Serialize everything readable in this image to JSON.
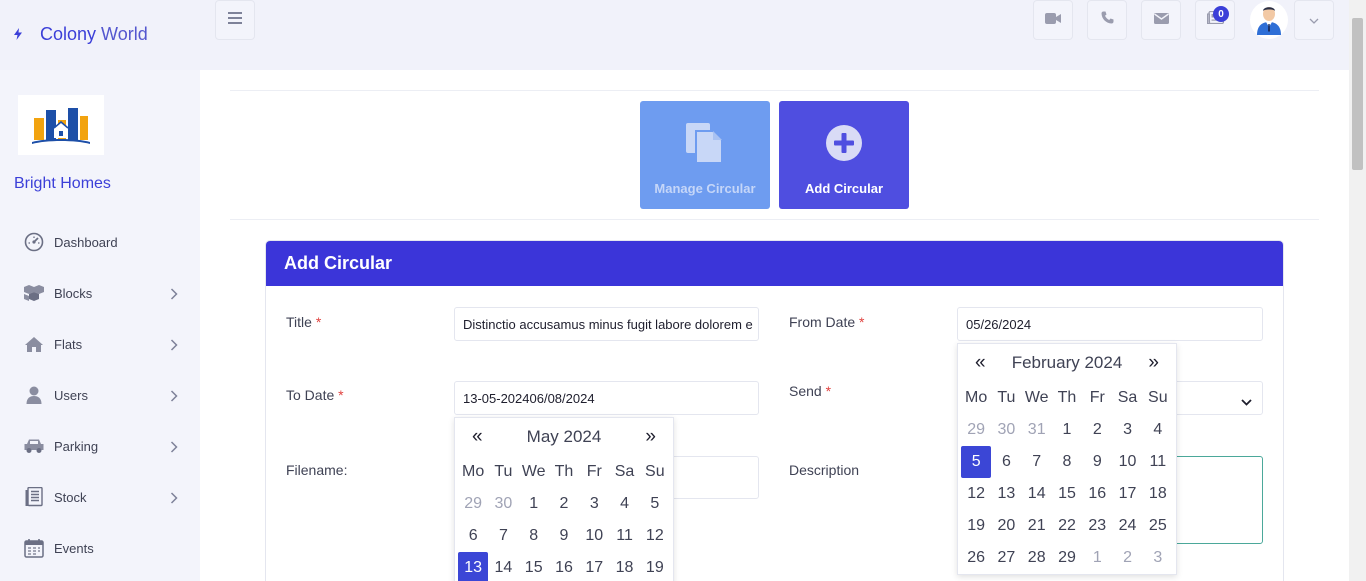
{
  "app": {
    "brand_first": "Colony",
    "brand_second": "World"
  },
  "topbar": {
    "menu_icon": "hamburger-icon",
    "actions": [
      {
        "name": "video-call",
        "icon": "video-icon"
      },
      {
        "name": "phone",
        "icon": "phone-icon"
      },
      {
        "name": "mail",
        "icon": "envelope-icon"
      },
      {
        "name": "notifications",
        "icon": "newspaper-icon",
        "badge": "0"
      }
    ],
    "user_menu_icon": "chevron-down-icon"
  },
  "sidebar": {
    "org_name": "Bright Homes",
    "items": [
      {
        "label": "Dashboard",
        "icon": "speedometer-icon",
        "has_children": false
      },
      {
        "label": "Blocks",
        "icon": "cubes-icon",
        "has_children": true
      },
      {
        "label": "Flats",
        "icon": "home-icon",
        "has_children": true
      },
      {
        "label": "Users",
        "icon": "user-icon",
        "has_children": true
      },
      {
        "label": "Parking",
        "icon": "car-icon",
        "has_children": true
      },
      {
        "label": "Stock",
        "icon": "stock-icon",
        "has_children": true
      },
      {
        "label": "Events",
        "icon": "calendar-icon",
        "has_children": false
      }
    ]
  },
  "tiles": {
    "manage": {
      "label": "Manage Circular",
      "icon": "documents-icon"
    },
    "add": {
      "label": "Add Circular",
      "icon": "plus-circle-icon"
    }
  },
  "form": {
    "heading": "Add Circular",
    "required_mark": "*",
    "title_label": "Title",
    "title_value": "Distinctio accusamus minus fugit labore dolorem e",
    "from_date_label": "From Date",
    "from_date_value": "05/26/2024",
    "to_date_label": "To Date",
    "to_date_value": "13-05-202406/08/2024",
    "send_label": "Send",
    "filename_label": "Filename:",
    "description_label": "Description"
  },
  "calendar_left": {
    "prev": "«",
    "next": "»",
    "month": "May 2024",
    "weekdays": [
      "Mo",
      "Tu",
      "We",
      "Th",
      "Fr",
      "Sa",
      "Su"
    ],
    "weeks": [
      [
        "29",
        "30",
        "1",
        "2",
        "3",
        "4",
        "5"
      ],
      [
        "6",
        "7",
        "8",
        "9",
        "10",
        "11",
        "12"
      ],
      [
        "13",
        "14",
        "15",
        "16",
        "17",
        "18",
        "19"
      ]
    ],
    "muted": [
      [
        0,
        0
      ],
      [
        0,
        1
      ]
    ],
    "selected": [
      2,
      0
    ]
  },
  "calendar_right": {
    "prev": "«",
    "next": "»",
    "month": "February 2024",
    "weekdays": [
      "Mo",
      "Tu",
      "We",
      "Th",
      "Fr",
      "Sa",
      "Su"
    ],
    "weeks": [
      [
        "29",
        "30",
        "31",
        "1",
        "2",
        "3",
        "4"
      ],
      [
        "5",
        "6",
        "7",
        "8",
        "9",
        "10",
        "11"
      ],
      [
        "12",
        "13",
        "14",
        "15",
        "16",
        "17",
        "18"
      ],
      [
        "19",
        "20",
        "21",
        "22",
        "23",
        "24",
        "25"
      ],
      [
        "26",
        "27",
        "28",
        "29",
        "1",
        "2",
        "3"
      ]
    ],
    "muted": [
      [
        0,
        0
      ],
      [
        0,
        1
      ],
      [
        0,
        2
      ],
      [
        4,
        4
      ],
      [
        4,
        5
      ],
      [
        4,
        6
      ]
    ],
    "selected": [
      1,
      0
    ]
  },
  "colors": {
    "accent": "#3b3fd8",
    "header": "#3b35d9",
    "tile_manage": "#6e9cf0",
    "tile_add": "#4f4ee0"
  }
}
